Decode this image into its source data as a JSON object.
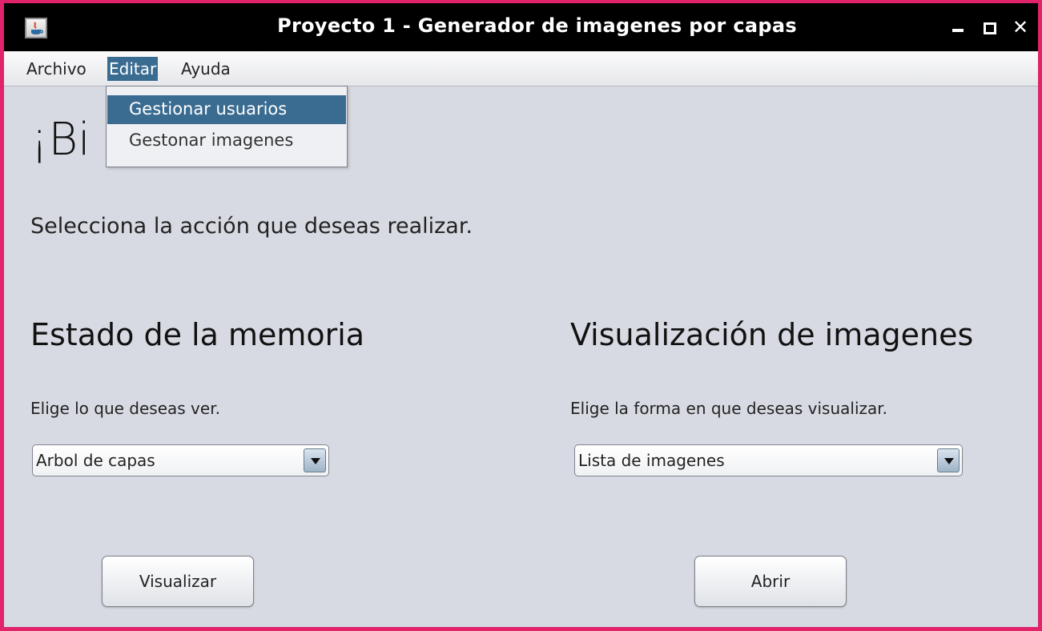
{
  "window": {
    "title": "Proyecto 1 - Generador de imagenes por capas",
    "controls": {
      "minimize": "minimize-icon",
      "maximize": "maximize-icon",
      "close": "close-icon"
    },
    "accent": "#e0236a"
  },
  "menubar": {
    "items": [
      {
        "label": "Archivo"
      },
      {
        "label": "Editar"
      },
      {
        "label": "Ayuda"
      }
    ]
  },
  "dropdown": {
    "items": [
      {
        "label": "Gestionar usuarios"
      },
      {
        "label": "Gestonar imagenes"
      }
    ],
    "highlight_color": "#3a6b91"
  },
  "main": {
    "welcome_visible": "¡Bi",
    "welcome_suffix": "!",
    "subtitle": "Selecciona la acción que deseas realizar.",
    "memory": {
      "title": "Estado de la memoria",
      "hint": "Elige lo que deseas ver.",
      "selected": "Arbol de capas",
      "button": "Visualizar"
    },
    "images": {
      "title": "Visualización de imagenes",
      "hint": "Elige la forma en que deseas visualizar.",
      "selected": "Lista de imagenes",
      "button": "Abrir"
    }
  }
}
